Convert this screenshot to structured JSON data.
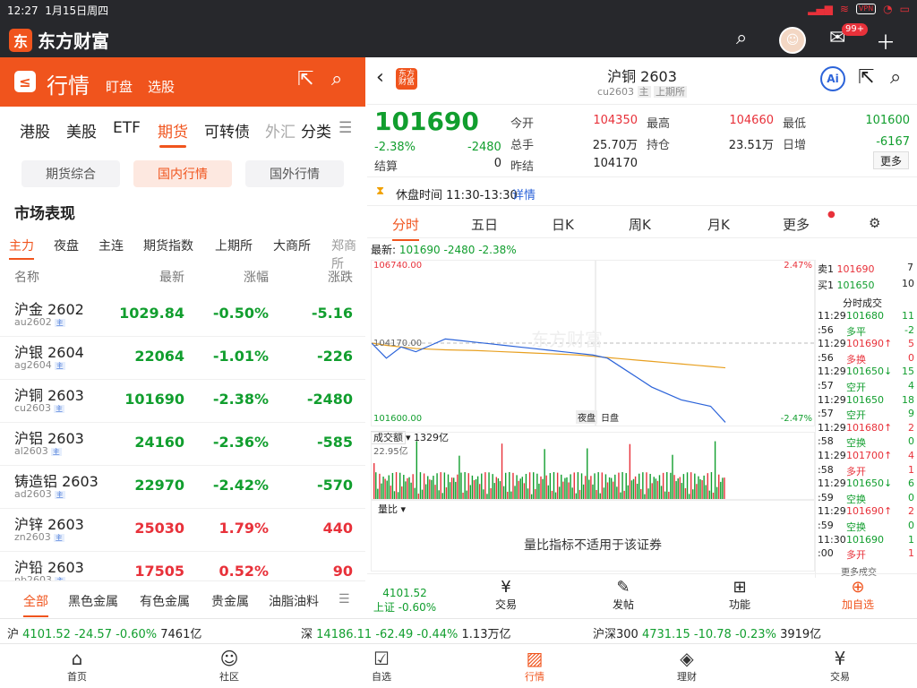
{
  "status": {
    "time": "12:27",
    "date": "1月15日周四",
    "vpn": "VPN"
  },
  "app": {
    "brand": "东方财富",
    "brand_glyph": "东",
    "mail_badge": "99+",
    "icons": [
      "search-icon",
      "avatar",
      "mail-icon",
      "plus-icon"
    ]
  },
  "left": {
    "title": "行情",
    "sub1": "盯盘",
    "sub2": "选股",
    "logo_glyph": "≤",
    "tabs": [
      "港股",
      "美股",
      "ETF",
      "期货",
      "可转债",
      "外汇",
      "分类"
    ],
    "subtabs": [
      "期货综合",
      "国内行情",
      "国外行情"
    ],
    "section_title": "市场表现",
    "categories": [
      "主力",
      "夜盘",
      "主连",
      "期货指数",
      "上期所",
      "大商所",
      "郑商所"
    ],
    "headers": {
      "name": "名称",
      "last": "最新",
      "pct": "涨幅",
      "chg": "涨跌"
    },
    "rows": [
      {
        "name": "沪金 2602",
        "code": "au2602",
        "tag": "主",
        "last": "1029.84",
        "pct": "-0.50%",
        "chg": "-5.16",
        "color": "g"
      },
      {
        "name": "沪银 2604",
        "code": "ag2604",
        "tag": "主",
        "last": "22064",
        "pct": "-1.01%",
        "chg": "-226",
        "color": "g"
      },
      {
        "name": "沪铜 2603",
        "code": "cu2603",
        "tag": "主",
        "last": "101690",
        "pct": "-2.38%",
        "chg": "-2480",
        "color": "g"
      },
      {
        "name": "沪铝 2603",
        "code": "al2603",
        "tag": "主",
        "last": "24160",
        "pct": "-2.36%",
        "chg": "-585",
        "color": "g"
      },
      {
        "name": "铸造铝 2603",
        "code": "ad2603",
        "tag": "主",
        "last": "22970",
        "pct": "-2.42%",
        "chg": "-570",
        "color": "g"
      },
      {
        "name": "沪锌 2603",
        "code": "zn2603",
        "tag": "主",
        "last": "25030",
        "pct": "1.79%",
        "chg": "440",
        "color": "r"
      },
      {
        "name": "沪铅 2603",
        "code": "pb2603",
        "tag": "主",
        "last": "17505",
        "pct": "0.52%",
        "chg": "90",
        "color": "r"
      }
    ],
    "bottom_tabs": [
      "全部",
      "黑色金属",
      "有色金属",
      "贵金属",
      "油脂油料"
    ]
  },
  "right": {
    "title": "沪铜 2603",
    "code": "cu2603",
    "tag1": "主",
    "tag2": "上期所",
    "ai": "Ai",
    "logo_glyph": "东方\n财富",
    "price": "101690",
    "pct": "-2.38%",
    "chg": "-2480",
    "quote": {
      "open_l": "今开",
      "open": "104350",
      "high_l": "最高",
      "high": "104660",
      "low_l": "最低",
      "low": "101600",
      "vol_l": "总手",
      "vol": "25.70万",
      "oi_l": "持仓",
      "oi": "23.51万",
      "doi_l": "日增",
      "doi": "-6167",
      "settle_l": "结算",
      "settle": "0",
      "prev_l": "昨结",
      "prev": "104170",
      "more": "更多"
    },
    "rest": {
      "text": "休盘时间 11:30-13:30",
      "detail": "详情"
    },
    "chart_tabs": [
      "分时",
      "五日",
      "日K",
      "周K",
      "月K",
      "更多"
    ],
    "latest": {
      "label": "最新:",
      "price": "101690",
      "chg": "-2480",
      "pct": "-2.38%"
    },
    "chart_labels": {
      "top": "106740.00",
      "top_pct": "2.47%",
      "mid": "104170.00",
      "bottom": "101600.00",
      "bottom_pct": "-2.47%",
      "night": "夜盘",
      "day": "日盘",
      "watermark": "东方财富"
    },
    "vol": {
      "label": "成交额",
      "value": "1329亿",
      "max": "22.95亿"
    },
    "ratio": {
      "label": "量比",
      "msg": "量比指标不适用于该证券"
    },
    "book": {
      "sell_l": "卖1",
      "sell": "101690",
      "sell_q": "7",
      "buy_l": "买1",
      "buy": "101650",
      "buy_q": "10",
      "hdr": "分时成交",
      "more": "更多成交"
    },
    "ticks": [
      {
        "t": "11:29",
        "p": "101680",
        "q": "11",
        "c": "g"
      },
      {
        "t": ":56",
        "p": "多平",
        "q": "-2",
        "c": "g"
      },
      {
        "t": "11:29",
        "p": "101690↑",
        "q": "5",
        "c": "r"
      },
      {
        "t": ":56",
        "p": "多换",
        "q": "0",
        "c": "r"
      },
      {
        "t": "11:29",
        "p": "101650↓",
        "q": "15",
        "c": "g"
      },
      {
        "t": ":57",
        "p": "空开",
        "q": "4",
        "c": "g"
      },
      {
        "t": "11:29",
        "p": "101650",
        "q": "18",
        "c": "g"
      },
      {
        "t": ":57",
        "p": "空开",
        "q": "9",
        "c": "g"
      },
      {
        "t": "11:29",
        "p": "101680↑",
        "q": "2",
        "c": "r"
      },
      {
        "t": ":58",
        "p": "空换",
        "q": "0",
        "c": "g"
      },
      {
        "t": "11:29",
        "p": "101700↑",
        "q": "4",
        "c": "r"
      },
      {
        "t": ":58",
        "p": "多开",
        "q": "1",
        "c": "r"
      },
      {
        "t": "11:29",
        "p": "101650↓",
        "q": "6",
        "c": "g"
      },
      {
        "t": ":59",
        "p": "空换",
        "q": "0",
        "c": "g"
      },
      {
        "t": "11:29",
        "p": "101690↑",
        "q": "2",
        "c": "r"
      },
      {
        "t": ":59",
        "p": "空换",
        "q": "0",
        "c": "g"
      },
      {
        "t": "11:30",
        "p": "101690",
        "q": "1",
        "c": "g"
      },
      {
        "t": ":00",
        "p": "多开",
        "q": "1",
        "c": "r"
      }
    ],
    "actions": [
      {
        "top": "4101.52",
        "bottom": "上证 -0.60%"
      },
      {
        "label": "交易"
      },
      {
        "label": "发帖"
      },
      {
        "label": "功能"
      },
      {
        "label": "加自选"
      }
    ]
  },
  "index_bar": [
    {
      "name": "沪",
      "value": "4101.52",
      "chg": "-24.57",
      "pct": "-0.60%",
      "amt": "7461亿"
    },
    {
      "name": "深",
      "value": "14186.11",
      "chg": "-62.49",
      "pct": "-0.44%",
      "amt": "1.13万亿"
    },
    {
      "name": "沪深300",
      "value": "4731.15",
      "chg": "-10.78",
      "pct": "-0.23%",
      "amt": "3919亿"
    }
  ],
  "tabbar": [
    "首页",
    "社区",
    "自选",
    "行情",
    "理财",
    "交易"
  ],
  "colors": {
    "accent": "#f0541d",
    "up": "#e8313a",
    "down": "#119e2e"
  },
  "chart_series": {
    "price": [
      104170,
      103700,
      104050,
      103900,
      104100,
      104300,
      104250,
      104200,
      104150,
      104100,
      104050,
      104000,
      103950,
      103900,
      103850,
      103800,
      103700,
      103400,
      103100,
      102800,
      102600,
      102400,
      102300,
      102200,
      101700
    ],
    "avg": [
      104170,
      104100,
      104050,
      104000,
      103980,
      103960,
      103950,
      103940,
      103920,
      103900,
      103880,
      103860,
      103840,
      103820,
      103800,
      103760,
      103720,
      103680,
      103640,
      103600,
      103560,
      103520,
      103480,
      103440,
      103400
    ]
  }
}
